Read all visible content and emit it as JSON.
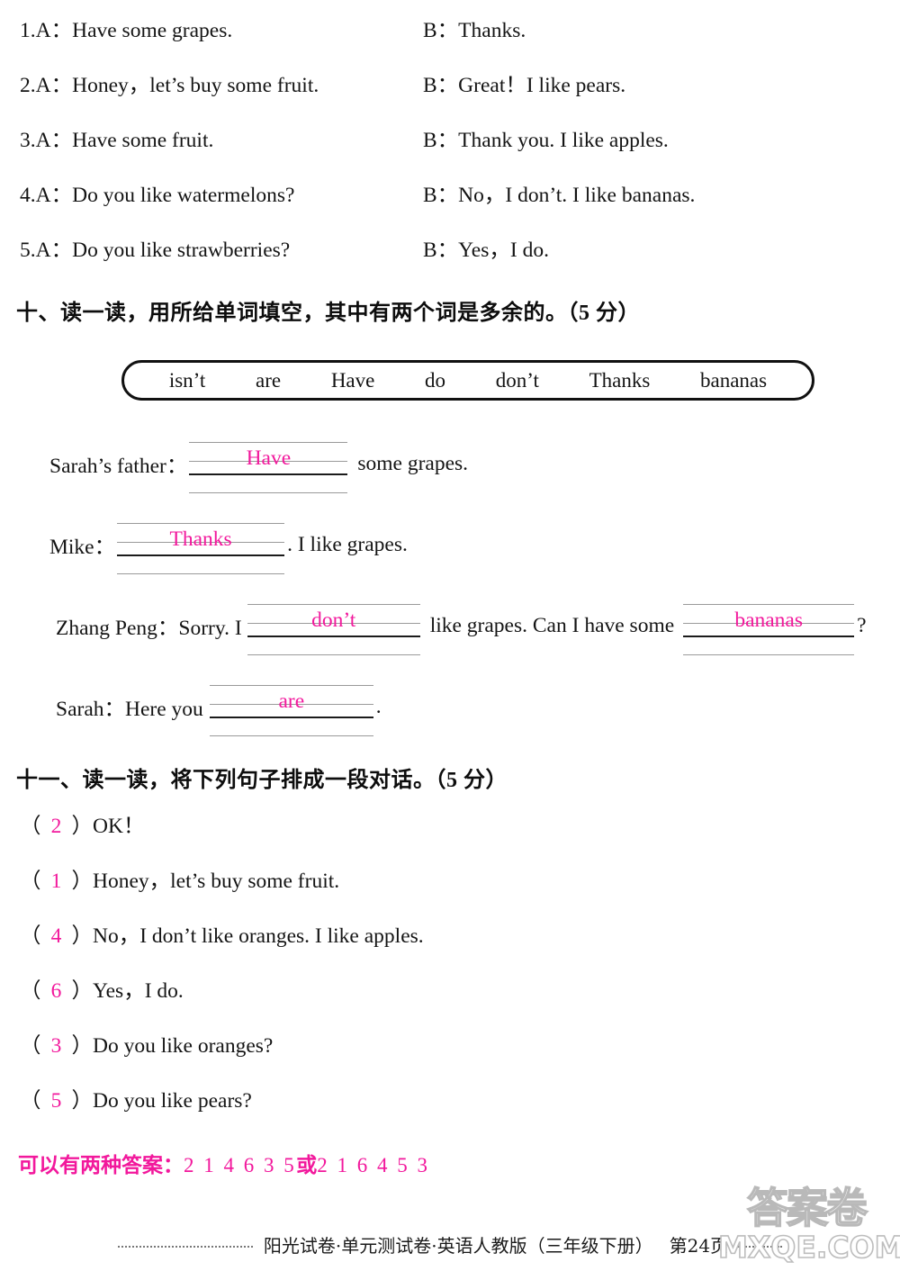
{
  "dialogue_pairs": {
    "items": [
      {
        "num": "1.",
        "a": "A：Have some grapes.",
        "b": "B：Thanks."
      },
      {
        "num": "2.",
        "a": "A：Honey，let’s buy some fruit.",
        "b": "B：Great！I like pears."
      },
      {
        "num": "3.",
        "a": "A：Have some fruit.",
        "b": "B：Thank you. I like apples."
      },
      {
        "num": "4.",
        "a": "A：Do you like watermelons?",
        "b": "B：No，I don’t. I like bananas."
      },
      {
        "num": "5.",
        "a": "A：Do you like strawberries?",
        "b": "B：Yes，I do."
      }
    ]
  },
  "section_ten": {
    "heading": "十、读一读，用所给单词填空，其中有两个词是多余的。",
    "points": "（5 分）",
    "word_bank": [
      "isn’t",
      "are",
      "Have",
      "do",
      "don’t",
      "Thanks",
      "bananas"
    ],
    "lines": [
      {
        "speaker": "Sarah’s father：",
        "answer": "Have",
        "tail": "some grapes."
      },
      {
        "speaker": "Mike：",
        "answer": "Thanks",
        "tail": ". I like grapes."
      },
      {
        "speaker": "Zhang Peng：Sorry. I",
        "answer": "don’t",
        "tail": "like grapes. Can I have some",
        "answer2": "bananas",
        "tail2": "?"
      },
      {
        "speaker": "Sarah：Here you",
        "answer": "are",
        "tail": "."
      }
    ]
  },
  "section_eleven": {
    "heading": "十一、读一读，将下列句子排成一段对话。",
    "points": "（5 分）",
    "items": [
      {
        "order": "2",
        "text": "OK！"
      },
      {
        "order": "1",
        "text": "Honey，let’s buy some fruit."
      },
      {
        "order": "4",
        "text": "No，I don’t like oranges. I like apples."
      },
      {
        "order": "6",
        "text": "Yes，I do."
      },
      {
        "order": "3",
        "text": "Do you like oranges?"
      },
      {
        "order": "5",
        "text": "Do you like pears?"
      }
    ],
    "answer_note_label": "可以有两种答案：",
    "answer_note_first": "2 1 4 6 3 5",
    "answer_note_conjunction": "或",
    "answer_note_second": "2 1 6 4 5 3"
  },
  "footer": {
    "text": "阳光试卷·单元测试卷·英语人教版（三年级下册）",
    "page": "第24页"
  },
  "watermark": {
    "seal": "答案卷",
    "domain": "MXQE.COM"
  },
  "colors": {
    "answer_pink": "#f2189c",
    "text_black": "#141414",
    "rule_gray": "#9a9a9a"
  }
}
